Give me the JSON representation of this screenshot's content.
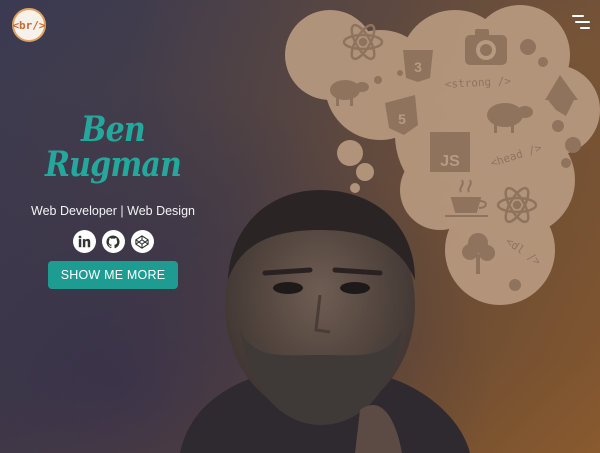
{
  "header": {
    "logo_text": "<br/>"
  },
  "intro": {
    "name": "Ben Rugman",
    "role": "Web Developer | Web Design",
    "socials": [
      {
        "icon": "linkedin-icon"
      },
      {
        "icon": "github-icon"
      },
      {
        "icon": "codepen-icon"
      }
    ],
    "cta_label": "SHOW ME MORE"
  },
  "thought_bubble": {
    "tag_strong": "<strong />",
    "tag_head": "<head />",
    "tag_dl": "<dl />",
    "js_label": "JS",
    "html_label": "5",
    "css_label": "3"
  },
  "colors": {
    "accent": "#24a89d",
    "button": "#1f9c92",
    "bubble": "#b89a80"
  }
}
